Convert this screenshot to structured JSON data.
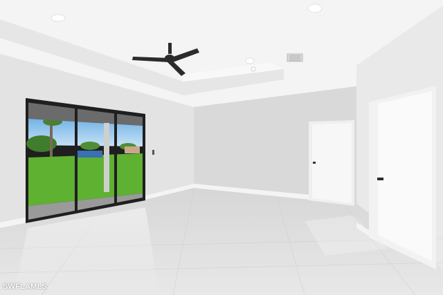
{
  "photo": {
    "watermark": "SWFLAMLS"
  },
  "palette": {
    "ceiling": "#f4f4f4",
    "tray_shadow": "#e2e2e2",
    "left_wall": "#e3e3e3",
    "back_wall": "#d9d9d9",
    "right_wall": "#e9e9e9",
    "floor": "#dedede",
    "door": "#f7f7f7",
    "baseboard": "#f2f2f2",
    "fan_dark": "#2b2b2b",
    "sky": "#8fc4ea",
    "lawn": "#5eb131",
    "patio": "#9a9a9a",
    "window_frame": "#1f1f1f"
  }
}
